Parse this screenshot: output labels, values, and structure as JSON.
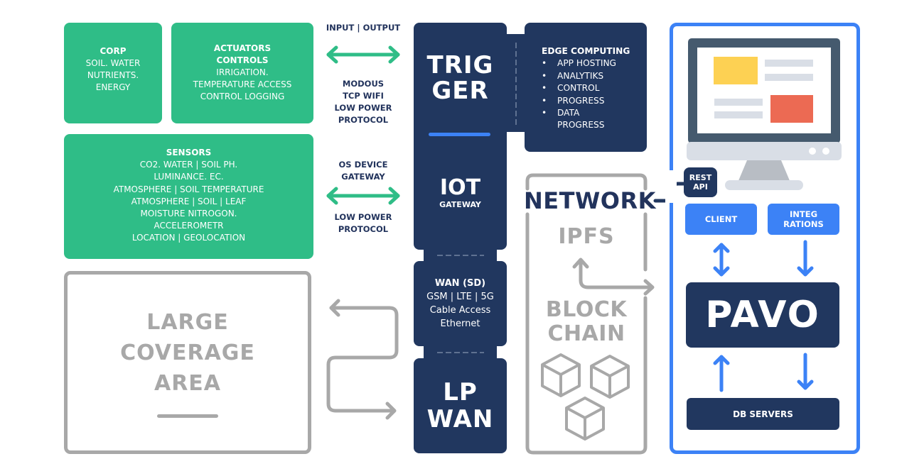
{
  "colors": {
    "green": "#2fbd87",
    "navy": "#21375f",
    "blue": "#3c82f6",
    "gray": "#a8a8a8",
    "label_dark": "#22335c",
    "monitor_frame": "#455a6e",
    "monitor_yellow": "#fdd153",
    "monitor_red": "#ec6a53",
    "monitor_gray": "#d9dee6"
  },
  "corp": {
    "title": "CORP",
    "lines": [
      "SOIL. WATER",
      "NUTRIENTS.",
      "ENERGY"
    ]
  },
  "actuators": {
    "title_lines": [
      "ACTUATORS",
      "CONTROLS"
    ],
    "lines": [
      "IRRIGATION.",
      "TEMPERATURE ACCESS",
      "CONTROL LOGGING"
    ]
  },
  "sensors": {
    "title": "SENSORS",
    "lines": [
      "CO2. WATER | SOIL PH.",
      "LUMINANCE. EC.",
      "ATMOSPHERE | SOIL TEMPERATURE",
      "ATMOSPHERE | SOIL | LEAF",
      "MOISTURE NITROGON.",
      "ACCELEROMETR",
      "LOCATION | GEOLOCATION"
    ]
  },
  "connectors": {
    "top_label": "INPUT | OUTPUT",
    "top_protocol": [
      "MODOUS",
      "TCP WIFI",
      "LOW POWER",
      "PROTOCOL"
    ],
    "mid_label": [
      "OS DEVICE",
      "GATEWAY"
    ],
    "mid_protocol": [
      "LOW POWER",
      "PROTOCOL"
    ]
  },
  "coverage": {
    "lines": [
      "LARGE",
      "COVERAGE",
      "AREA"
    ]
  },
  "trigger": {
    "lines": [
      "TRIG",
      "GER"
    ]
  },
  "edge": {
    "title": "EDGE COMPUTING",
    "items": [
      "APP HOSTING",
      "ANALYTIKS",
      "CONTROL",
      "PROGRESS",
      "DATA PROGRESS"
    ]
  },
  "iot": {
    "title": "IOT",
    "subtitle": "GATEWAY"
  },
  "wan": {
    "title": "WAN (SD)",
    "lines": [
      "GSM | LTE | 5G",
      "Cable Access",
      "Ethernet"
    ]
  },
  "lpwan": {
    "lines": [
      "LP",
      "WAN"
    ]
  },
  "network": {
    "title": "NETWORK",
    "ipfs": "IPFS",
    "blockchain_lines": [
      "BLOCK",
      "CHAIN"
    ]
  },
  "right_panel": {
    "rest_api_lines": [
      "REST",
      "API"
    ],
    "client": "CLIENT",
    "integrations_lines": [
      "INTEG",
      "RATIONS"
    ],
    "pavo": "PAVO",
    "db_servers": "DB SERVERS"
  }
}
